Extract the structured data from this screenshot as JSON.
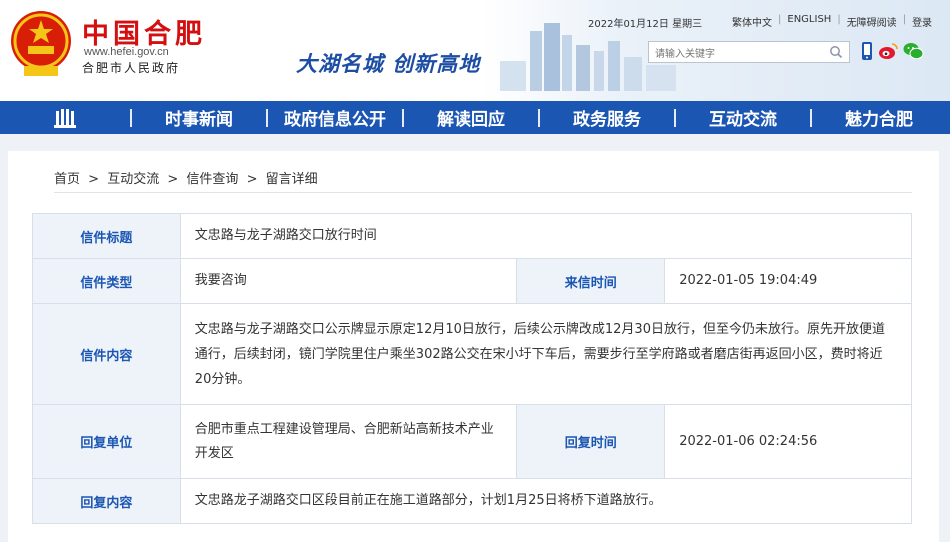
{
  "header": {
    "site_name": "中国合肥",
    "site_url": "www.hefei.gov.cn",
    "site_sub": "合肥市人民政府",
    "slogan": "大湖名城  创新高地",
    "date": "2022年01月12日 星期三",
    "links": [
      "繁体中文",
      "ENGLISH",
      "无障碍阅读",
      "登录"
    ],
    "search_placeholder": "请输入关键字"
  },
  "nav": {
    "items": [
      "时事新闻",
      "政府信息公开",
      "解读回应",
      "政务服务",
      "互动交流",
      "魅力合肥"
    ]
  },
  "breadcrumb": [
    "首页",
    "互动交流",
    "信件查询",
    "留言详细"
  ],
  "breadcrumb_sep": ">",
  "letter": {
    "title_label": "信件标题",
    "title": "文忠路与龙子湖路交口放行时间",
    "type_label": "信件类型",
    "type": "我要咨询",
    "time_label": "来信时间",
    "time": "2022-01-05 19:04:49",
    "content_label": "信件内容",
    "content": "文忠路与龙子湖路交口公示牌显示原定12月10日放行，后续公示牌改成12月30日放行，但至今仍未放行。原先开放便道通行，后续封闭，镜门学院里住户乘坐302路公交在宋小圩下车后，需要步行至学府路或者磨店街再返回小区，费时将近20分钟。",
    "reply_unit_label": "回复单位",
    "reply_unit": "合肥市重点工程建设管理局、合肥新站高新技术产业开发区",
    "reply_time_label": "回复时间",
    "reply_time": "2022-01-06 02:24:56",
    "reply_content_label": "回复内容",
    "reply_content": "文忠路龙子湖路交口区段目前正在施工道路部分，计划1月25日将桥下道路放行。"
  },
  "colors": {
    "nav_bg": "#1c56b3",
    "brand_red": "#d40f0f",
    "label_text": "#1c56b3",
    "label_bg": "#eef3fa"
  }
}
